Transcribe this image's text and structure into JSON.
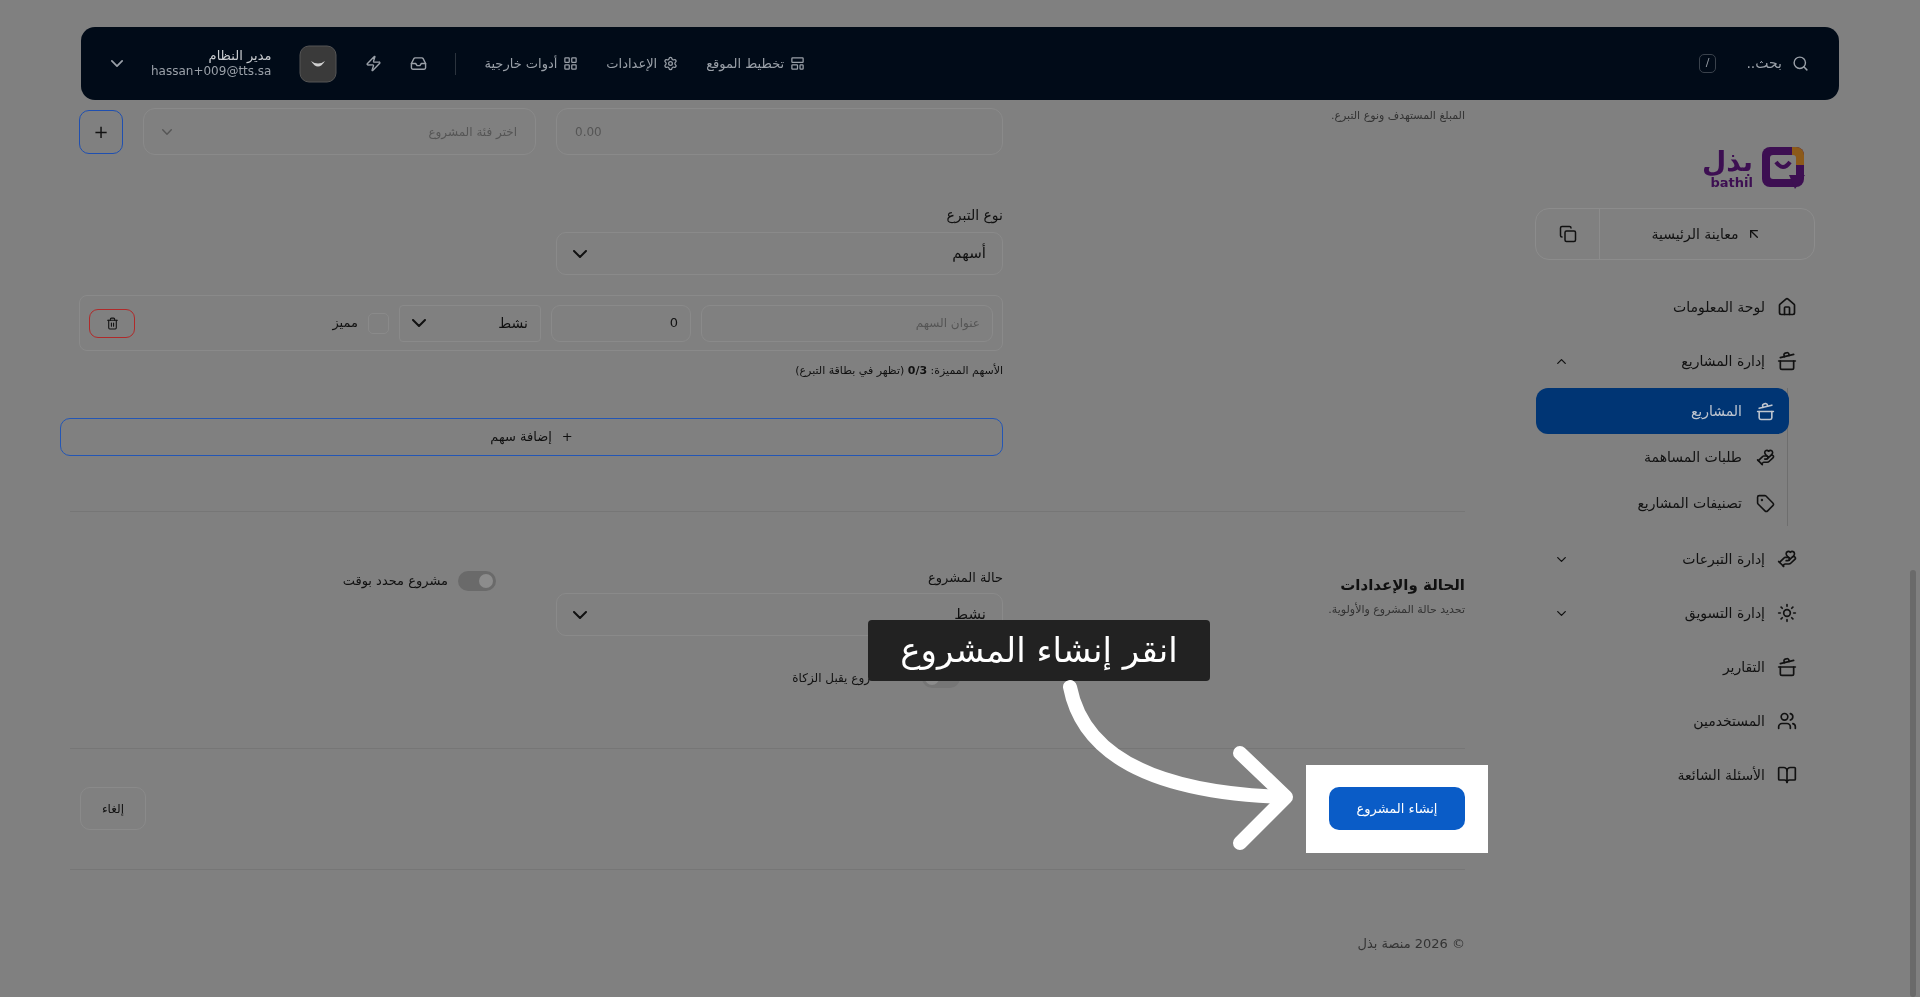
{
  "top_bar": {
    "search": {
      "placeholder": "بحث..",
      "shortcut": "/"
    },
    "nav": [
      {
        "label": "تخطيط الموقع"
      },
      {
        "label": "الإعدادات"
      },
      {
        "label": "أدوات خارجية"
      }
    ],
    "user": {
      "name": "مدير النظام",
      "email": "hassan+009@tts.sa"
    }
  },
  "sidebar": {
    "logo": {
      "arabic": "بذل",
      "latin": "bathil"
    },
    "preview_button": "معاينة الرئيسية",
    "items": [
      {
        "label": "لوحة المعلومات",
        "selected": false
      },
      {
        "label": "إدارة المشاريع",
        "selected": false,
        "expanded": true,
        "children": [
          {
            "label": "المشاريع",
            "selected": true
          },
          {
            "label": "طلبات المساهمة",
            "selected": false
          },
          {
            "label": "تصنيفات المشاريع",
            "selected": false
          }
        ]
      },
      {
        "label": "إدارة التبرعات",
        "selected": false,
        "expanded": false
      },
      {
        "label": "إدارة التسويق",
        "selected": false,
        "expanded": false
      },
      {
        "label": "التقارير",
        "selected": false
      },
      {
        "label": "المستخدمين",
        "selected": false
      },
      {
        "label": "الأسئلة الشائعة",
        "selected": false
      }
    ]
  },
  "basic_section": {
    "description": "المبلغ المستهدف ونوع التبرع.",
    "target_amount": {
      "placeholder": "0.00"
    },
    "category": {
      "placeholder": "اختر فئة المشروع"
    },
    "add_category_button": "+",
    "donation_type": {
      "label": "نوع التبرع",
      "value": "أسهم"
    },
    "shares": [
      {
        "title_placeholder": "عنوان السهم",
        "amount": "0",
        "status": "نشط",
        "featured": false,
        "featured_label": "مميز"
      }
    ],
    "featured_note": "الأسهم المميزة: **0/3** (تظهر في بطاقة التبرع)",
    "add_share_button": {
      "icon": "+",
      "label": "إضافة سهم"
    }
  },
  "status_section": {
    "title": "الحالة والإعدادات",
    "subtitle": "تحديد حالة المشروع والأولوية.",
    "status": {
      "label": "حالة المشروع",
      "value": "نشط"
    },
    "toggles": [
      {
        "label": "مشروع محدد بوقت",
        "on": true
      },
      {
        "label": "روع يقبل الزكاة",
        "on": false
      }
    ]
  },
  "actions": {
    "cancel": "إلغاء",
    "create": "إنشاء المشروع"
  },
  "tutorial": {
    "callout": "انقر إنشاء المشروع"
  },
  "footer": "© 2026 منصة بذل"
}
